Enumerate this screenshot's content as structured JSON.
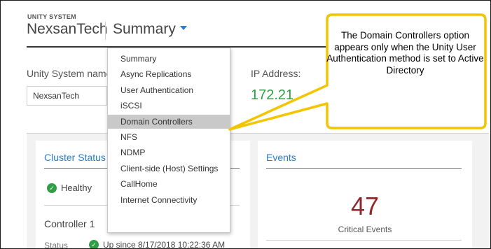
{
  "header": {
    "system_label": "UNITY SYSTEM",
    "system_name": "NexsanTech",
    "current_page": "Summary"
  },
  "form": {
    "name_label": "Unity System name",
    "name_value": "NexsanTech",
    "ip_label": "IP Address:",
    "ip_value": "172.21"
  },
  "menu": {
    "items": [
      {
        "label": "Summary"
      },
      {
        "label": "Async Replications"
      },
      {
        "label": "User Authentication"
      },
      {
        "label": "iSCSI"
      },
      {
        "label": "Domain Controllers"
      },
      {
        "label": "NFS"
      },
      {
        "label": "NDMP"
      },
      {
        "label": "Client-side (Host) Settings"
      },
      {
        "label": "CallHome"
      },
      {
        "label": "Internet Connectivity"
      }
    ],
    "highlighted": "Domain Controllers"
  },
  "cluster_card": {
    "title": "Cluster Status",
    "health": "Healthy",
    "controller": "Controller 1",
    "status_label": "Status",
    "status_value": "Up since 8/17/2018 10:22:36 AM"
  },
  "events_card": {
    "title": "Events",
    "count": "47",
    "count_label": "Critical Events"
  },
  "callout": {
    "text": "The Domain Controllers option appears only when the Unity User Authentication method is set to Active Directory"
  },
  "colors": {
    "accent": "#2a7bd0",
    "healthy": "#2f9e44",
    "critical": "#8b2a2a",
    "callout_border": "#f2c500",
    "menu_highlight": "#c9c9c9"
  },
  "icons": {
    "dropdown": "caret-down-icon",
    "health": "check-circle-icon"
  }
}
